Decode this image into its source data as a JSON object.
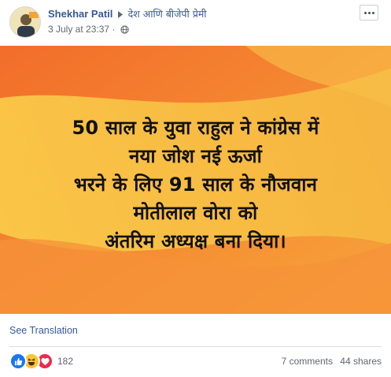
{
  "post": {
    "author_name": "Shekhar Patil",
    "group_name": "देश आणि बीजेपी प्रेमी",
    "timestamp": "3 July at 23:37",
    "separator": "·",
    "privacy_icon": "globe-icon",
    "options_icon": "more-options-icon"
  },
  "image": {
    "lines": [
      "50 साल के युवा राहुल ने कांग्रेस में",
      "नया जोश नई ऊर्जा",
      "भरने के लिए 91 साल के नौजवान",
      "मोतीलाल वोरा को",
      "अंतरिम अध्यक्ष बना दिया।"
    ],
    "colors": {
      "orange": "#f4822b",
      "yellow": "#f8cf47",
      "text": "#111111"
    }
  },
  "footer": {
    "see_translation": "See Translation",
    "reaction_icons": [
      "like-icon",
      "haha-icon",
      "love-icon"
    ],
    "reaction_count": "182",
    "comments": "7 comments",
    "shares": "44 shares"
  },
  "colors": {
    "link": "#385898",
    "meta": "#616770",
    "like": "#1877f2",
    "love": "#f0284a",
    "haha": "#f7c634"
  }
}
